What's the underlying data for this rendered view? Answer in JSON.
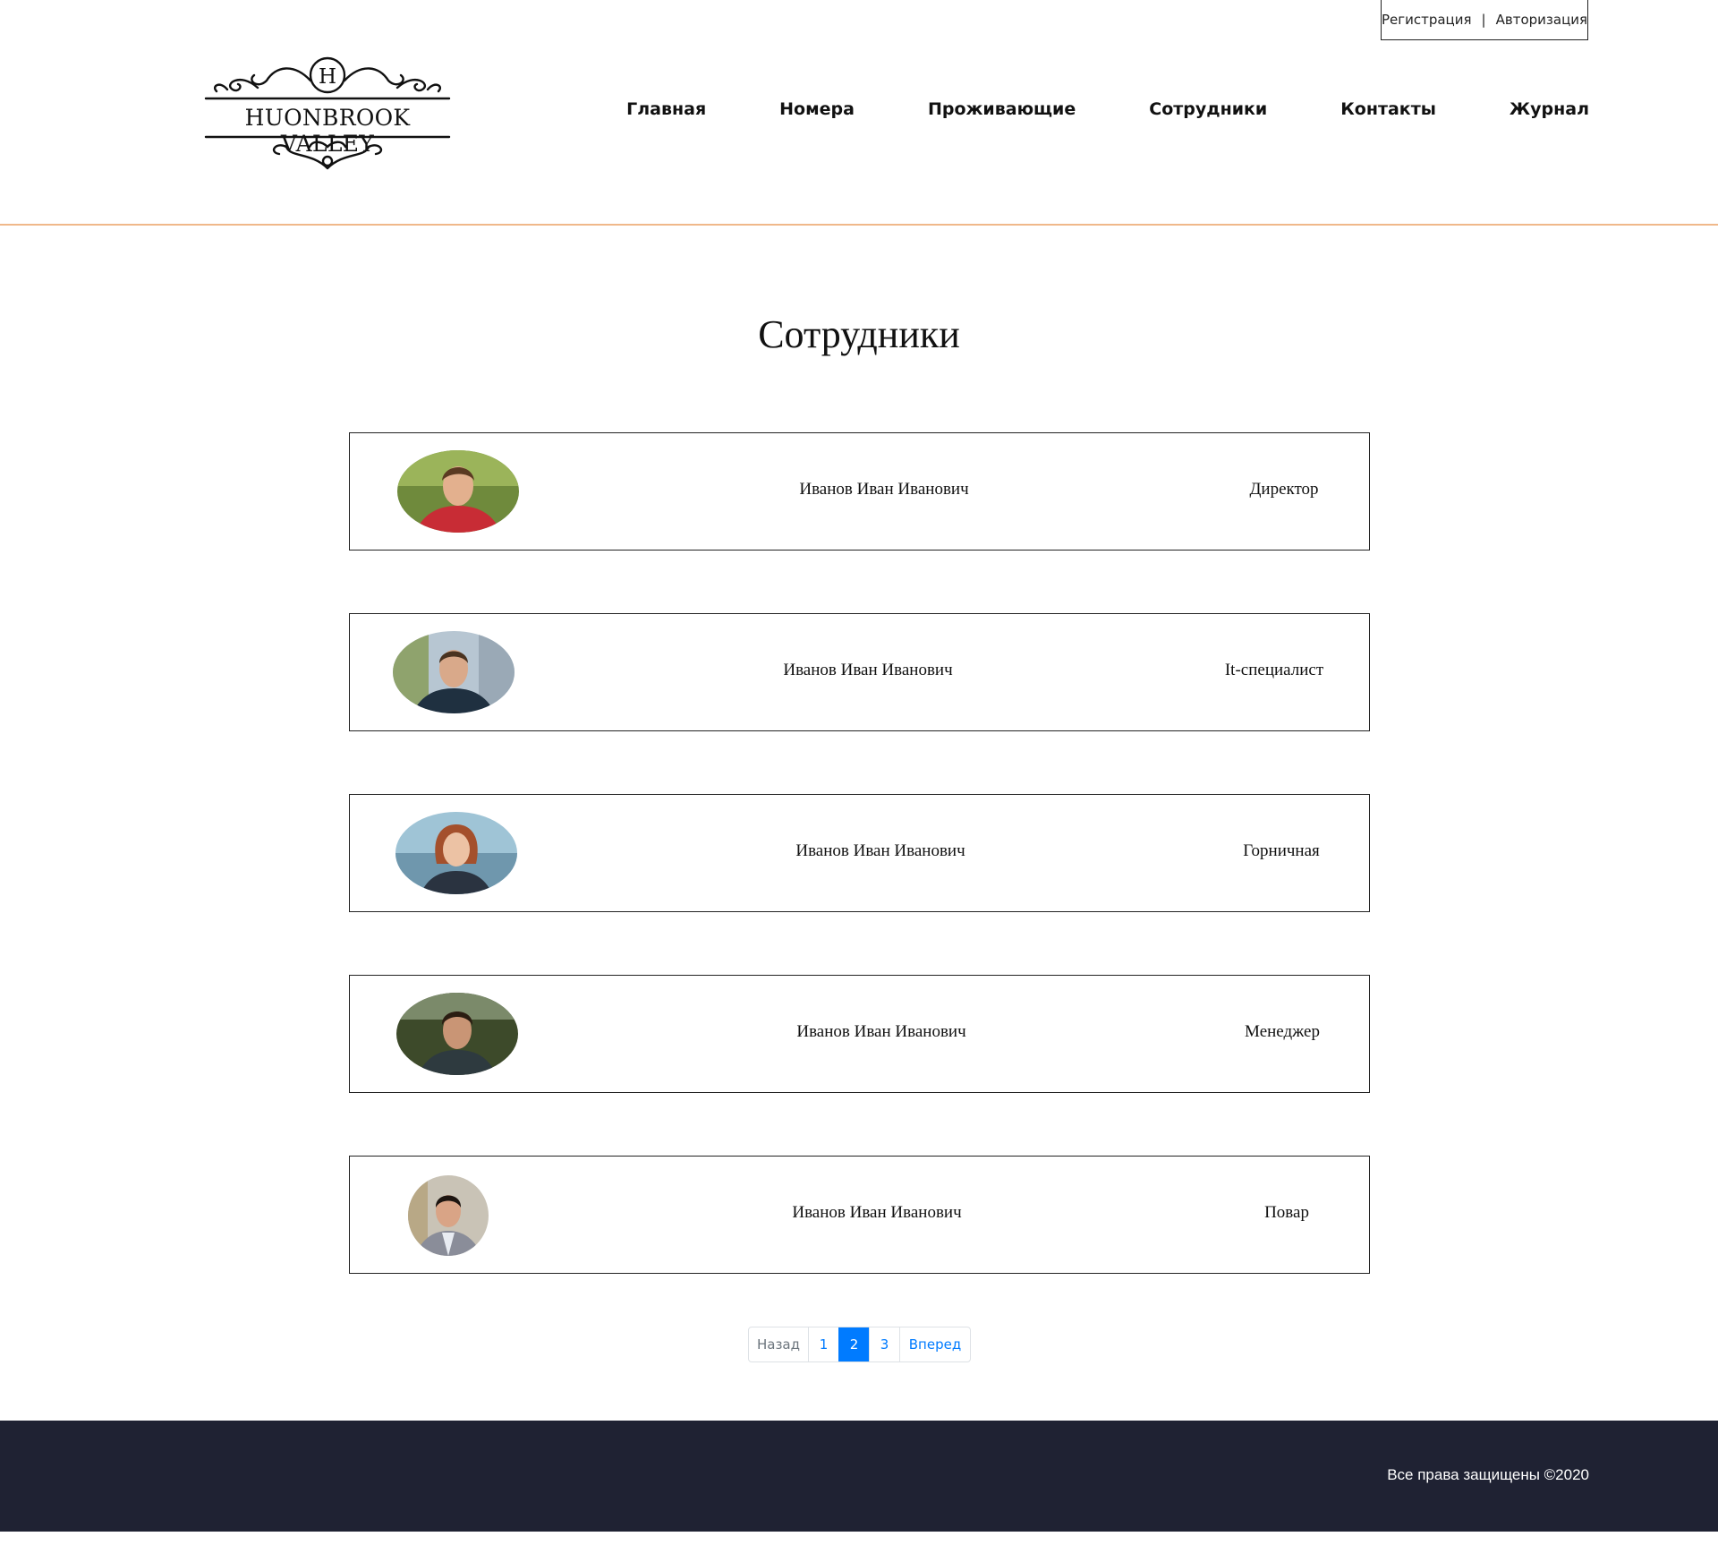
{
  "header": {
    "auth": {
      "register": "Регистрация",
      "separator": "|",
      "login": "Авторизация"
    },
    "logo": {
      "letter": "H",
      "text": "HUONBROOK VALLEY"
    },
    "nav": [
      "Главная",
      "Номера",
      "Проживающие",
      "Сотрудники",
      "Контакты",
      "Журнал"
    ],
    "accent_line_color": "#f0b88a"
  },
  "main": {
    "title": "Сотрудники",
    "employees": [
      {
        "name": "Иванов Иван Иванович",
        "role": "Директор"
      },
      {
        "name": "Иванов Иван Иванович",
        "role": "It-специалист"
      },
      {
        "name": "Иванов Иван Иванович",
        "role": "Горничная"
      },
      {
        "name": "Иванов Иван Иванович",
        "role": "Менеджер"
      },
      {
        "name": "Иванов Иван Иванович",
        "role": "Повар"
      }
    ]
  },
  "pagination": {
    "prev": "Назад",
    "pages": [
      "1",
      "2",
      "3"
    ],
    "active": "2",
    "next": "Вперед",
    "accent": "#007bff"
  },
  "footer": {
    "text": "Все права защищены ©2020",
    "background": "#1f2233"
  }
}
